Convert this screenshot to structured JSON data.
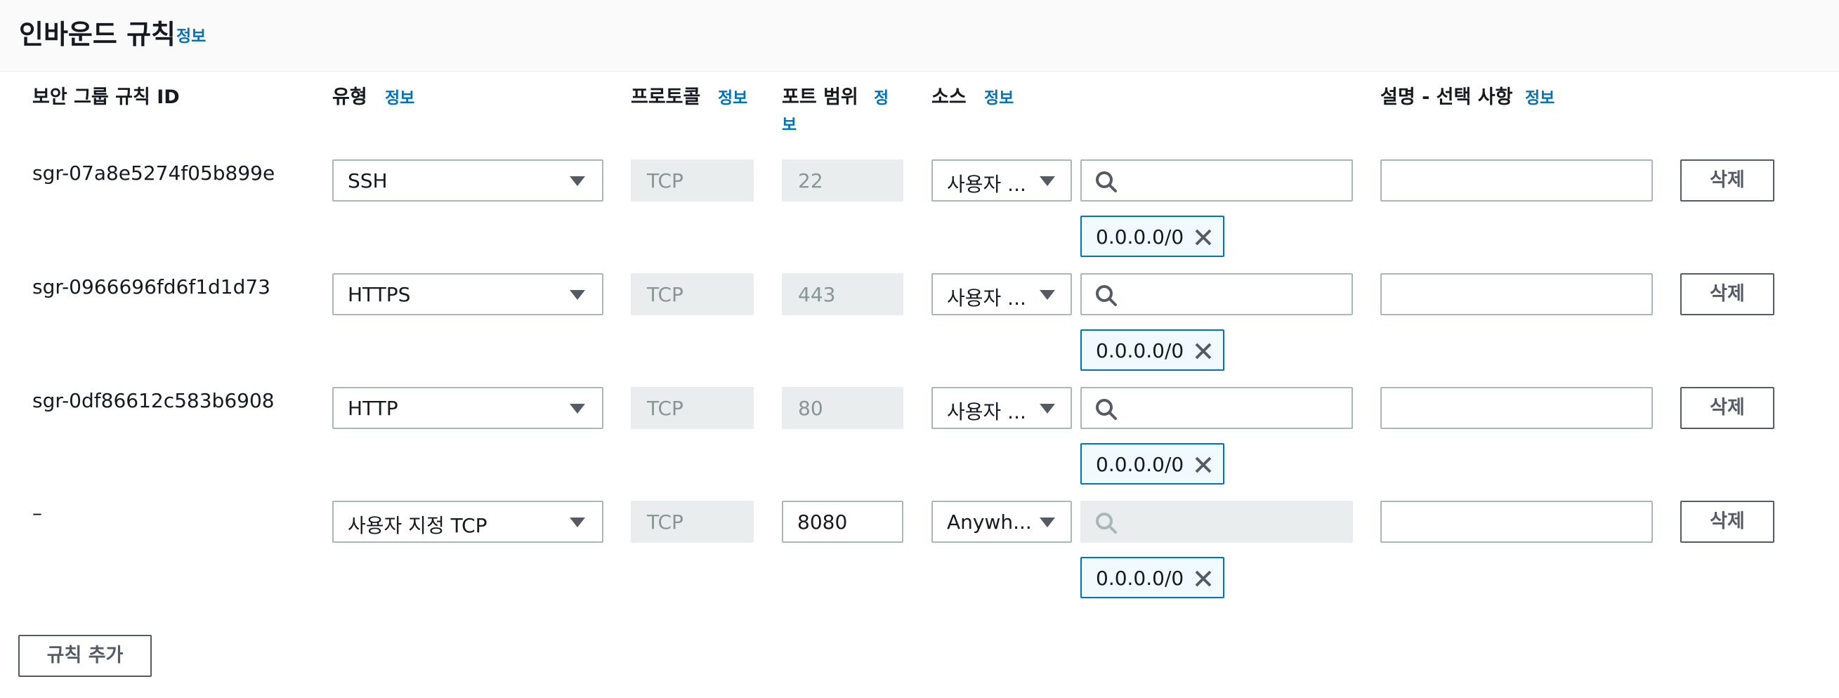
{
  "header": {
    "title": "인바운드 규칙",
    "info": "정보"
  },
  "columns": {
    "rule_id": "보안 그룹 규칙 ID",
    "type": "유형",
    "type_info": "정보",
    "protocol": "프로토콜",
    "protocol_info": "정보",
    "port_range": "포트 범위",
    "port_info_line1": "정",
    "port_info_line2": "보",
    "source": "소스",
    "source_info": "정보",
    "description": "설명 - 선택 사항",
    "description_info": "정보"
  },
  "rules": [
    {
      "id": "sgr-07a8e5274f05b899e",
      "type": "SSH",
      "protocol": "TCP",
      "port": "22",
      "source_type": "사용자 ...",
      "search": "",
      "cidr": "0.0.0.0/0",
      "description": "",
      "delete_label": "삭제"
    },
    {
      "id": "sgr-0966696fd6f1d1d73",
      "type": "HTTPS",
      "protocol": "TCP",
      "port": "443",
      "source_type": "사용자 ...",
      "search": "",
      "cidr": "0.0.0.0/0",
      "description": "",
      "delete_label": "삭제"
    },
    {
      "id": "sgr-0df86612c583b6908",
      "type": "HTTP",
      "protocol": "TCP",
      "port": "80",
      "source_type": "사용자 ...",
      "search": "",
      "cidr": "0.0.0.0/0",
      "description": "",
      "delete_label": "삭제"
    },
    {
      "id": "–",
      "type": "사용자 지정 TCP",
      "protocol": "TCP",
      "port": "8080",
      "source_type": "Anywh...",
      "search": "",
      "cidr": "0.0.0.0/0",
      "description": "",
      "delete_label": "삭제"
    }
  ],
  "add_rule_label": "규칙 추가",
  "colors": {
    "link": "#0073bb",
    "token_border": "#0073bb",
    "token_bg": "#f1faff",
    "disabled_bg": "#eaeded",
    "border": "#aab7b8"
  }
}
